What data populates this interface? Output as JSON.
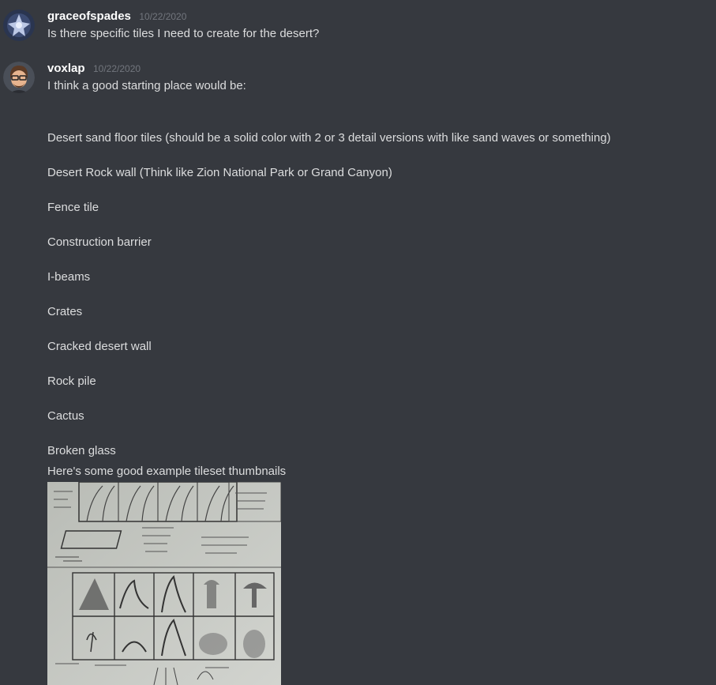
{
  "messages": [
    {
      "username": "graceofspades",
      "timestamp": "10/22/2020",
      "lines": [
        "Is there specific tiles I need to create for the desert?"
      ],
      "avatar_icon": "blue-crest-avatar",
      "name_color": "#ffffff"
    },
    {
      "username": "voxlap",
      "timestamp": "10/22/2020",
      "lines": [
        "I think a good starting place would be:",
        "Desert sand floor tiles (should be a solid color with 2 or 3 detail versions with like sand waves or something)",
        "Desert Rock wall (Think like Zion National Park or Grand Canyon)",
        "Fence tile",
        "Construction barrier",
        "I-beams",
        "Crates",
        "Cracked desert wall",
        "Rock pile",
        "Cactus",
        "Broken glass",
        "Here's some good example tileset thumbnails"
      ],
      "avatar_icon": "bearded-man-avatar"
    }
  ],
  "attachment": {
    "kind": "sketch-image",
    "description_icon": "pencil-sketch-tileset-thumbnails"
  },
  "colors": {
    "background": "#36393f",
    "text": "#dcddde",
    "timestamp": "#72767d",
    "username": "#ffffff"
  }
}
